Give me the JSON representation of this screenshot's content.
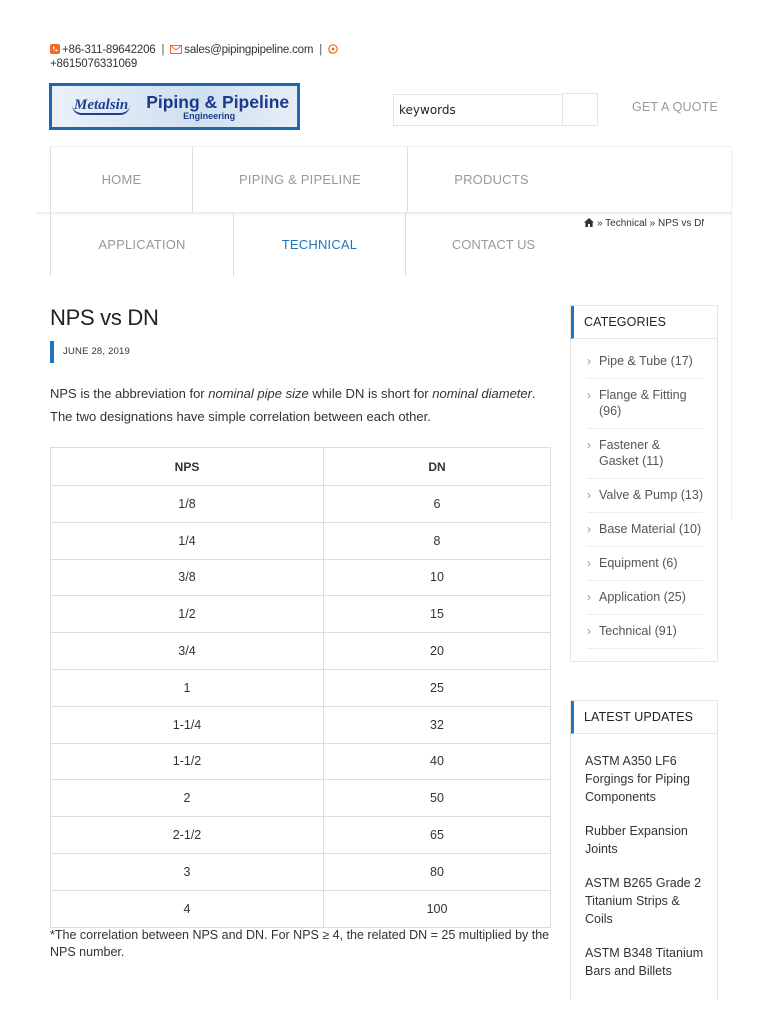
{
  "topbar": {
    "phone": "+86-311-89642206",
    "email": "sales@pipingpipeline.com",
    "whatsapp": "+8615076331069",
    "separator": "|"
  },
  "logo": {
    "brand": "Metalsin",
    "title": "Piping & Pipeline",
    "subtitle": "Engineering"
  },
  "search": {
    "value": "keywords",
    "placeholder": "keywords"
  },
  "quote_label": "GET A QUOTE",
  "nav": {
    "row1": [
      "HOME",
      "PIPING & PIPELINE",
      "PRODUCTS"
    ],
    "row2": [
      "APPLICATION",
      "TECHNICAL",
      "CONTACT US"
    ],
    "active": "TECHNICAL"
  },
  "breadcrumb": {
    "sep1": "»",
    "parent": "Technical",
    "sep2": "»",
    "current": "NPS vs DN"
  },
  "article": {
    "title": "NPS vs DN",
    "date": "JUNE 28, 2019",
    "intro_1": "NPS is the abbreviation for ",
    "intro_em1": "nominal pipe size",
    "intro_2": " while DN is short for ",
    "intro_em2": "nominal diameter",
    "intro_3": ". The two designations have simple correlation between each other.",
    "table_headers": [
      "NPS",
      "DN"
    ],
    "table_rows": [
      [
        "1/8",
        "6"
      ],
      [
        "1/4",
        "8"
      ],
      [
        "3/8",
        "10"
      ],
      [
        "1/2",
        "15"
      ],
      [
        "3/4",
        "20"
      ],
      [
        "1",
        "25"
      ],
      [
        "1-1/4",
        "32"
      ],
      [
        "1-1/2",
        "40"
      ],
      [
        "2",
        "50"
      ],
      [
        "2-1/2",
        "65"
      ],
      [
        "3",
        "80"
      ],
      [
        "4",
        "100"
      ]
    ],
    "note": "*The correlation between NPS and DN. For NPS ≥ 4, the related DN = 25 multiplied by the NPS number."
  },
  "sidebar": {
    "categories_title": "CATEGORIES",
    "categories": [
      "Pipe & Tube (17)",
      "Flange & Fitting (96)",
      "Fastener & Gasket (11)",
      "Valve & Pump (13)",
      "Base Material (10)",
      "Equipment (6)",
      "Application (25)",
      "Technical (91)"
    ],
    "updates_title": "LATEST UPDATES",
    "updates": [
      "ASTM A350 LF6 Forgings for Piping Components",
      "Rubber Expansion Joints",
      "ASTM B265 Grade 2 Titanium Strips & Coils",
      "ASTM B348 Titanium Bars and Billets"
    ]
  },
  "colors": {
    "accent": "#1f76bd",
    "contact_icon": "#f26b21",
    "nav_text": "#999999"
  },
  "icons": [
    "phone-icon",
    "mail-icon",
    "whatsapp-icon",
    "home-icon",
    "chevron-right-icon"
  ]
}
